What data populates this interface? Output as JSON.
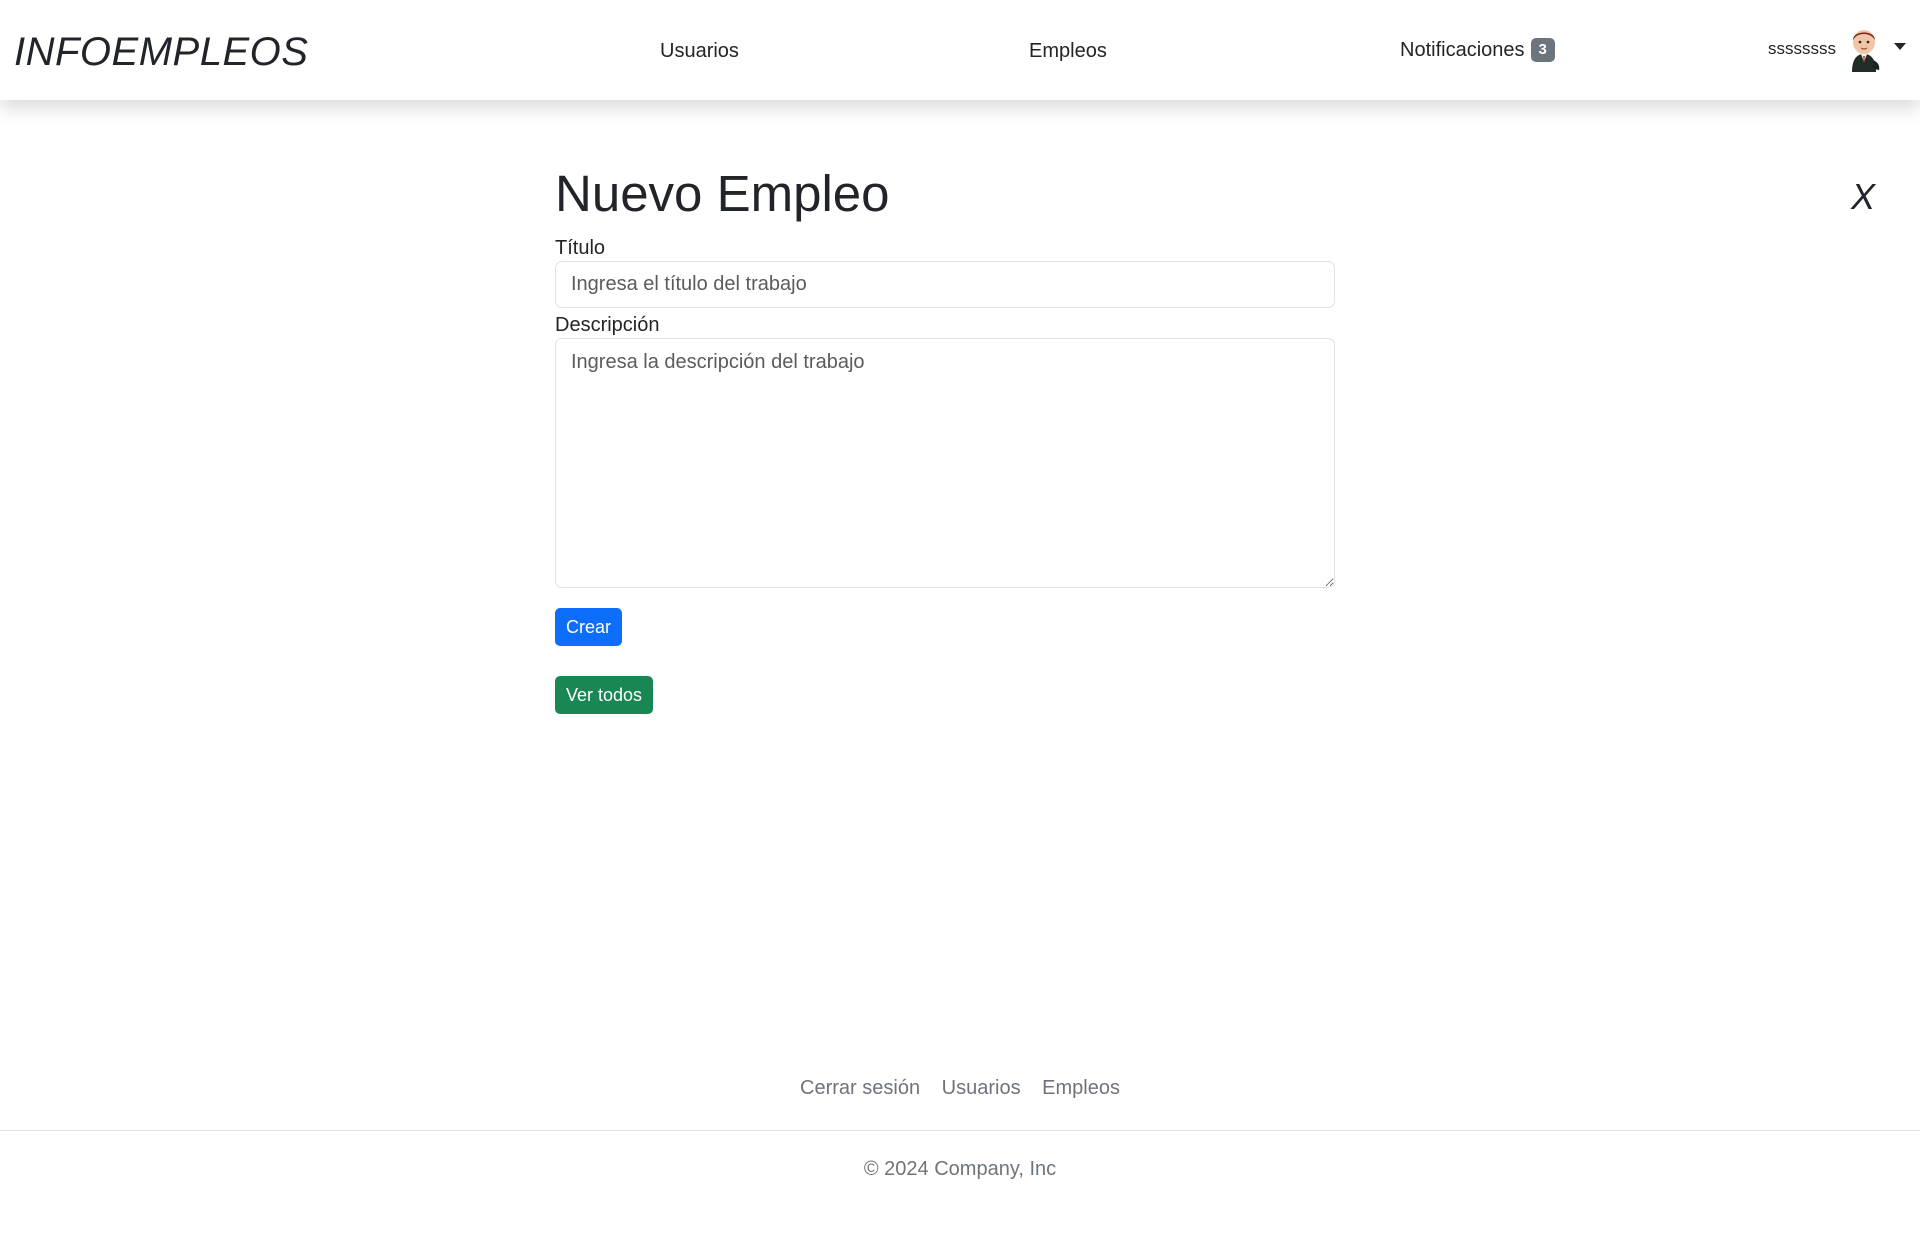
{
  "navbar": {
    "brand": "INFOEMPLEOS",
    "links": {
      "usuarios": "Usuarios",
      "empleos": "Empleos",
      "notificaciones": "Notificaciones"
    },
    "notification_count": "3",
    "username": "ssssssss",
    "avatar_icon": "user-avatar-cartoon",
    "dropdown_icon": "caret-down-icon"
  },
  "form": {
    "title": "Nuevo Empleo",
    "close_label": "X",
    "titulo_label": "Título",
    "titulo_placeholder": "Ingresa el título del trabajo",
    "titulo_value": "",
    "descripcion_label": "Descripción",
    "descripcion_placeholder": "Ingresa la descripción del trabajo",
    "descripcion_value": "",
    "submit_label": "Crear",
    "view_all_label": "Ver todos"
  },
  "footer": {
    "links": {
      "logout": "Cerrar sesión",
      "usuarios": "Usuarios",
      "empleos": "Empleos"
    },
    "copyright": "© 2024 Company, Inc"
  },
  "colors": {
    "primary": "#0d6efd",
    "success": "#198754",
    "badge": "#6c757d",
    "text": "#212529",
    "muted": "#6c757d"
  }
}
